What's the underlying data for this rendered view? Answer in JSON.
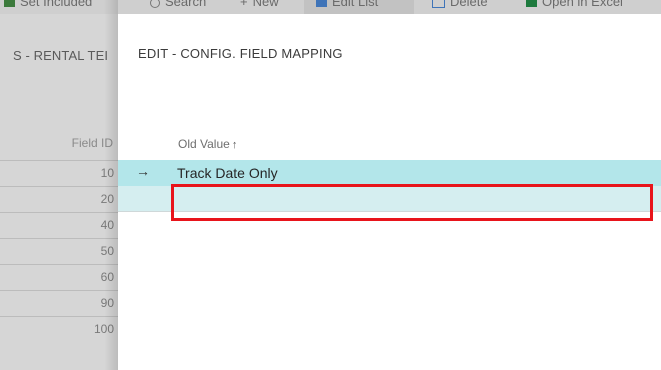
{
  "background_page": {
    "commands": [
      {
        "label": "Set Included",
        "icon": "check-icon"
      },
      {
        "label": "Search",
        "icon": "search-icon"
      },
      {
        "label": "New",
        "icon": "plus-icon"
      },
      {
        "label": "Edit List",
        "icon": "edit-list-icon"
      },
      {
        "label": "Delete",
        "icon": "delete-icon"
      },
      {
        "label": "Open in Excel",
        "icon": "excel-icon"
      }
    ],
    "title": "S - RENTAL TEI",
    "column_header": "Field ID",
    "field_ids": [
      "10",
      "20",
      "40",
      "50",
      "60",
      "90",
      "100"
    ]
  },
  "dialog": {
    "title": "EDIT - CONFIG. FIELD MAPPING",
    "column_header": "Old Value",
    "sort_indicator": "↑",
    "row_indicator": "→",
    "rows": [
      {
        "old_value": "Track Date Only"
      },
      {
        "old_value": ""
      }
    ]
  },
  "colors": {
    "selected_row": "#b3e6ea",
    "new_row": "#d5eef0",
    "highlight": "#e8141b"
  }
}
